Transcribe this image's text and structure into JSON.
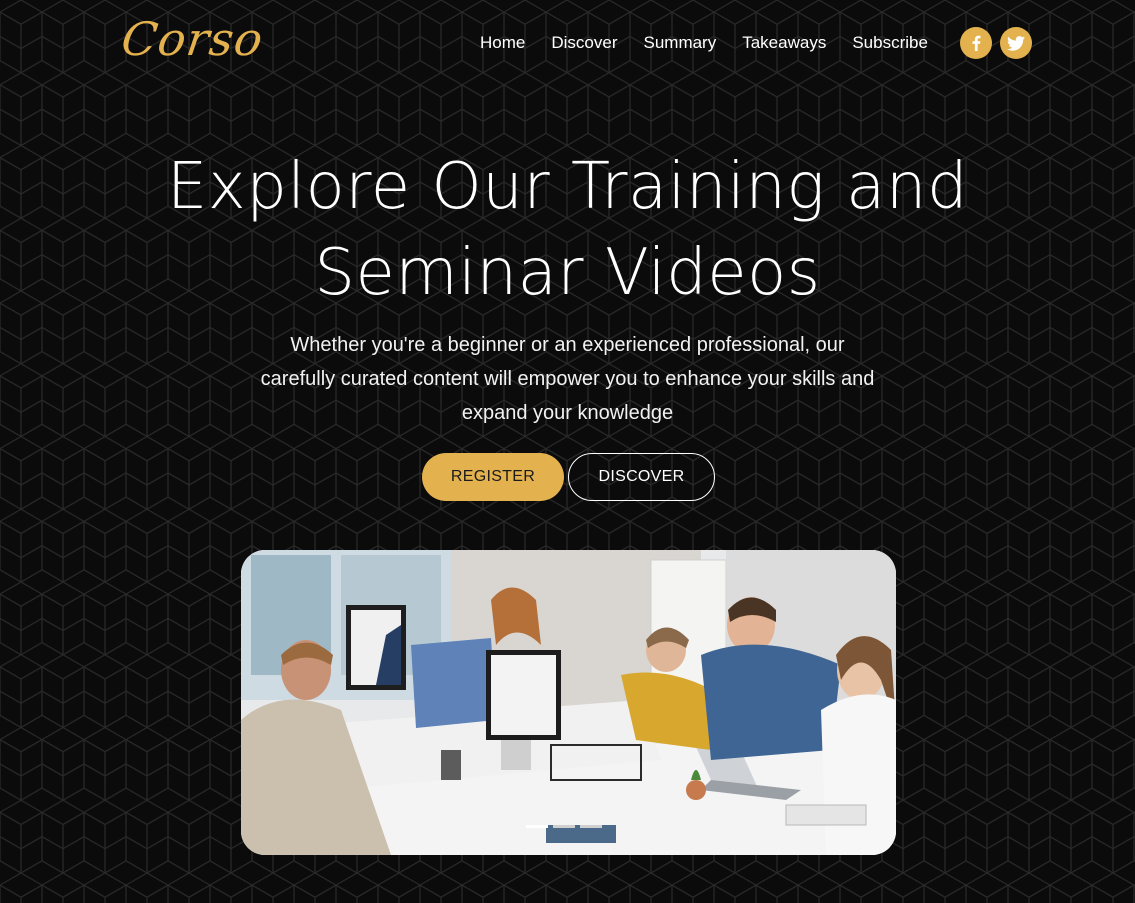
{
  "brand": {
    "logo_text": "Corso",
    "accent_color": "#e3b24e",
    "background_color": "#0b0b0b"
  },
  "nav": {
    "items": [
      {
        "label": "Home"
      },
      {
        "label": "Discover"
      },
      {
        "label": "Summary"
      },
      {
        "label": "Takeaways"
      },
      {
        "label": "Subscribe"
      }
    ]
  },
  "social": {
    "icons": [
      "facebook-icon",
      "twitter-icon"
    ]
  },
  "hero": {
    "title_line1": "Explore Our Training and",
    "title_line2": "Seminar Videos",
    "subtitle_line1": "Whether you're a beginner or an experienced professional, our",
    "subtitle_line2": "carefully curated content will empower you to enhance your skills and",
    "subtitle_line3": "expand your knowledge",
    "register_label": "REGISTER",
    "discover_label": "DISCOVER"
  },
  "image": {
    "icon": "office-training-photo"
  }
}
